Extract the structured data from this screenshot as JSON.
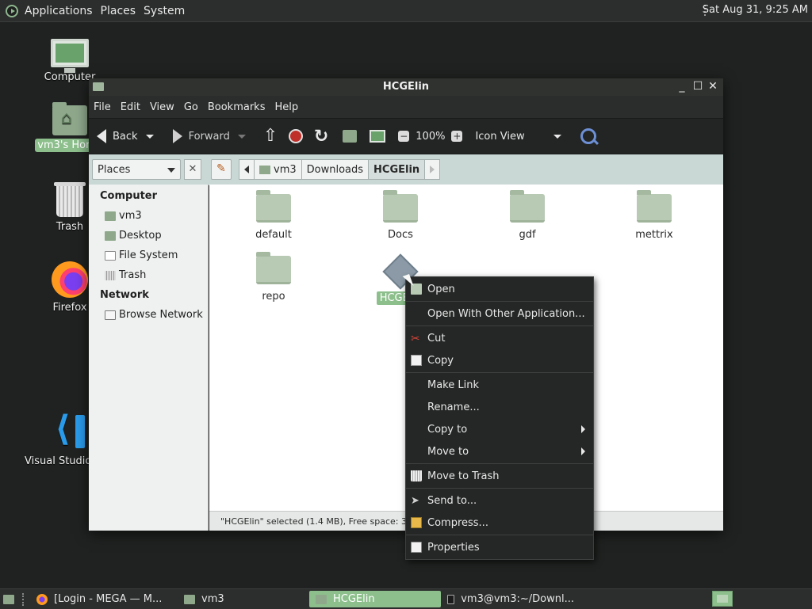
{
  "top_panel": {
    "menus": [
      "Applications",
      "Places",
      "System"
    ],
    "clock": "Sat Aug 31,  9:25 AM"
  },
  "desktop_icons": {
    "computer": "Computer",
    "home": "vm3's Home",
    "trash": "Trash",
    "firefox": "Firefox",
    "vscode": "Visual Studio Code"
  },
  "window": {
    "title": "HCGElin",
    "menus": [
      "File",
      "Edit",
      "View",
      "Go",
      "Bookmarks",
      "Help"
    ],
    "toolbar": {
      "back": "Back",
      "forward": "Forward",
      "zoom": "100%",
      "view_mode": "Icon View"
    },
    "location": {
      "places": "Places",
      "crumbs": [
        "vm3",
        "Downloads",
        "HCGElin"
      ]
    },
    "sidebar": {
      "computer_header": "Computer",
      "computer_items": [
        "vm3",
        "Desktop",
        "File System",
        "Trash"
      ],
      "network_header": "Network",
      "network_items": [
        "Browse Network"
      ]
    },
    "files": [
      "default",
      "Docs",
      "gdf",
      "mettrix",
      "repo",
      "HCGElin"
    ],
    "status": "\"HCGElin\" selected (1.4 MB), Free space: 34.3 GB"
  },
  "context_menu": {
    "open": "Open",
    "open_with": "Open With Other Application...",
    "cut": "Cut",
    "copy": "Copy",
    "make_link": "Make Link",
    "rename": "Rename...",
    "copy_to": "Copy to",
    "move_to": "Move to",
    "move_to_trash": "Move to Trash",
    "send_to": "Send to...",
    "compress": "Compress...",
    "properties": "Properties"
  },
  "taskbar": {
    "tasks": [
      "[Login - MEGA — M...",
      "vm3",
      "HCGElin",
      "vm3@vm3:~/Downl..."
    ]
  },
  "colors": {
    "selection": "#8cbf8c",
    "panel": "#2b2e2c",
    "location_bar": "#c9d7d5"
  }
}
